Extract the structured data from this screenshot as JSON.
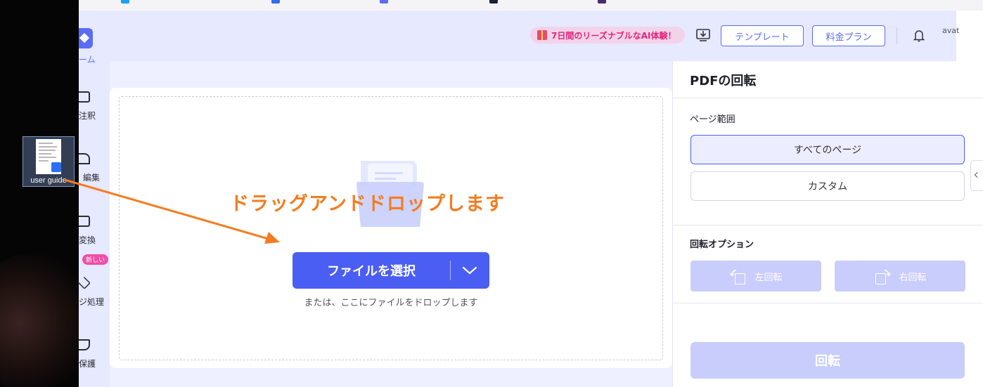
{
  "desktop": {
    "icon_label": "user guide"
  },
  "nav": {
    "logo_label": "ーム",
    "items": [
      {
        "label": "注釈"
      },
      {
        "label": "編集"
      },
      {
        "label": "変換"
      },
      {
        "label": "ジ処理"
      },
      {
        "label": "保護"
      }
    ],
    "new_badge": "新しい"
  },
  "topbar": {
    "promo": "7日間のリーズナブルなAI体験！",
    "template_button": "テンプレート",
    "pricing_button": "料金プラン",
    "avatar_alt": "avat"
  },
  "main": {
    "drag_caption": "ドラッグアンドドロップします",
    "select_button": "ファイルを選択",
    "drop_hint": "または、ここにファイルをドロップします"
  },
  "panel": {
    "title": "PDFの回転",
    "page_range_label": "ページ範囲",
    "all_pages": "すべてのページ",
    "custom": "カスタム",
    "rotation_options_label": "回転オプション",
    "rotate_left": "左回転",
    "rotate_right": "右回転",
    "rotate_button": "回転"
  },
  "colors": {
    "accent": "#4b5ef3",
    "annotation": "#f47c20",
    "disabled": "#c9cdfb"
  }
}
